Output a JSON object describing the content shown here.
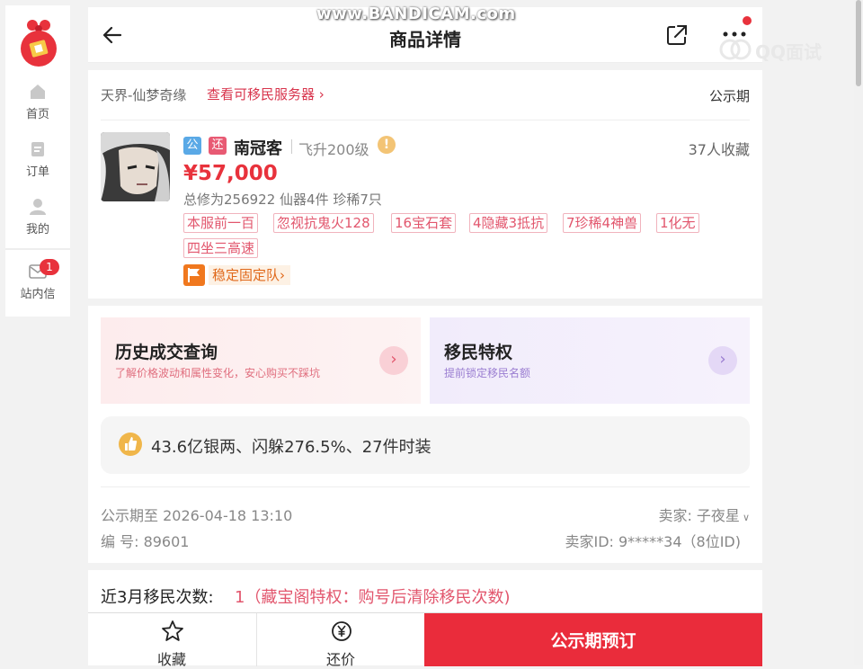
{
  "watermark": {
    "top": "www.BANDICAM.com",
    "right": "QQ面试"
  },
  "sidebar": {
    "items": [
      {
        "label": "首页",
        "icon": "home-icon"
      },
      {
        "label": "订单",
        "icon": "order-icon"
      },
      {
        "label": "我的",
        "icon": "user-icon"
      },
      {
        "label": "站内信",
        "icon": "mail-icon",
        "badge": "1"
      }
    ]
  },
  "header": {
    "title": "商品详情"
  },
  "product": {
    "server": "天界-仙梦奇缘",
    "server_link": "查看可移民服务器 ›",
    "phase": "公示期",
    "tag_public": "公",
    "tag_bargain": "还",
    "role_name": "南冠客",
    "level": "飞升200级",
    "warn": "!",
    "favorites": "37人收藏",
    "price": "¥57,000",
    "stats": "总修为256922  仙器4件  珍稀7只",
    "chips": [
      "本服前一百",
      "忽视抗鬼火128",
      "16宝石套",
      "4隐藏3抵抗",
      "7珍稀4神兽",
      "1化无",
      "四坐三高速"
    ],
    "team": "稳定固定队›"
  },
  "promos": [
    {
      "title": "历史成交查询",
      "subtitle": "了解价格波动和属性变化，安心购买不踩坑",
      "arrow": "›"
    },
    {
      "title": "移民特权",
      "subtitle": "提前锁定移民名额",
      "arrow": "›"
    }
  ],
  "highlight": "43.6亿银两、闪躲276.5%、27件时装",
  "info": {
    "pub_date": "公示期至 2026-04-18 13:10",
    "seller": "卖家: 子夜星",
    "serial": "编 号: 89601",
    "seller_id": "卖家ID: 9*****34（8位ID)"
  },
  "migration": {
    "label": "近3月移民次数:",
    "value": "1（藏宝阁特权：购号后清除移民次数)"
  },
  "bottombar": {
    "fav": "收藏",
    "offer": "还价",
    "reserve": "公示期预订"
  },
  "colors": {
    "accent": "#ea2c3b",
    "pink": "#e2566d",
    "purple": "#9a7dd1",
    "orange": "#f0781e"
  }
}
